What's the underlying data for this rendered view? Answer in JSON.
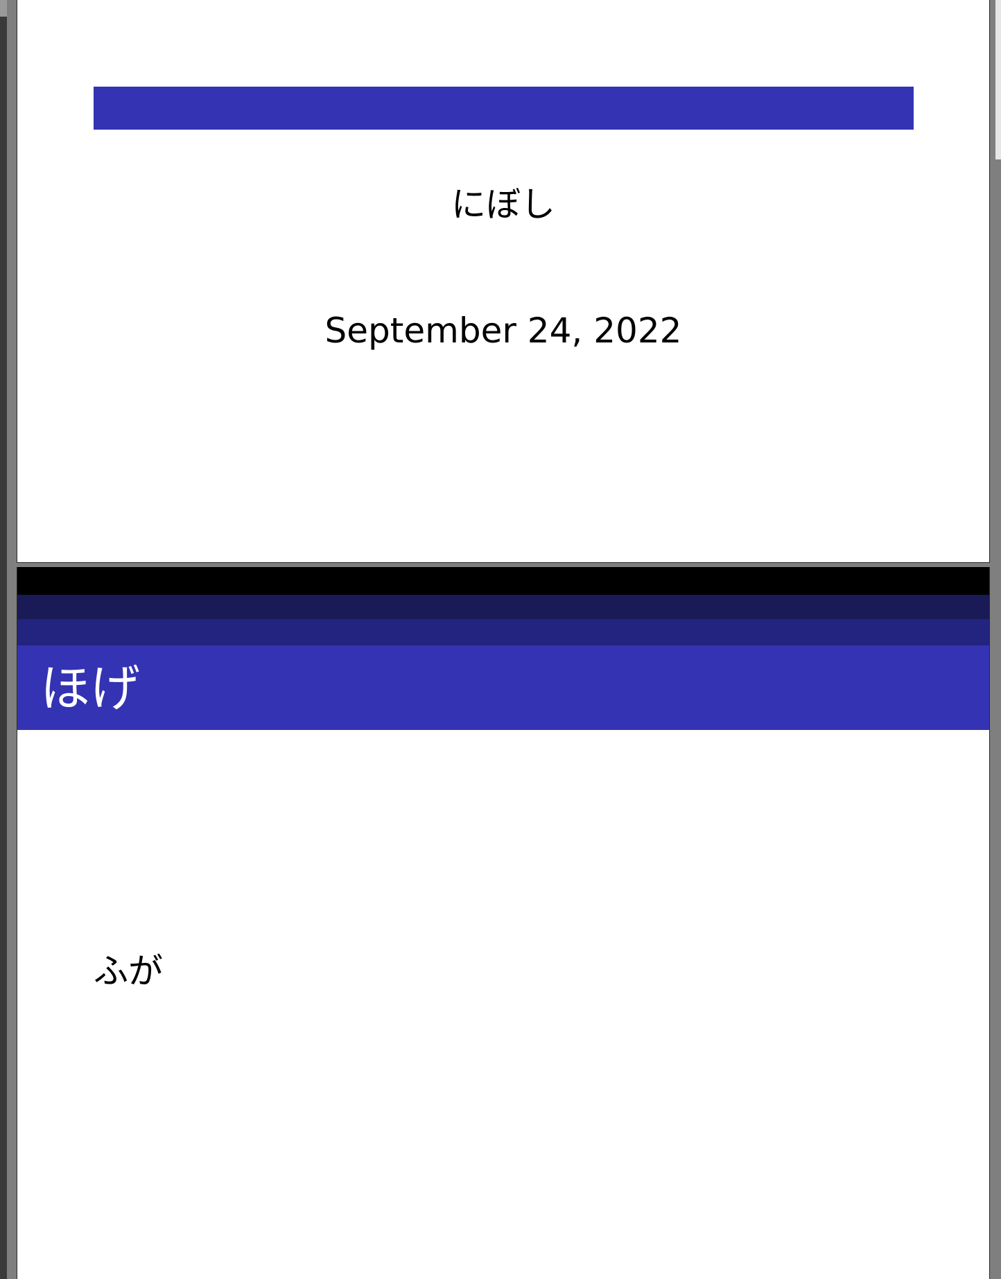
{
  "slides": [
    {
      "author": "にぼし",
      "date": "September 24, 2022"
    },
    {
      "frame_title": "ほげ",
      "body_text": "ふが"
    }
  ],
  "colors": {
    "beamer_blue": "#3333b3",
    "header_dark_1": "#1a1a57",
    "header_dark_2": "#232380",
    "viewer_background": "#7f7f7f"
  }
}
